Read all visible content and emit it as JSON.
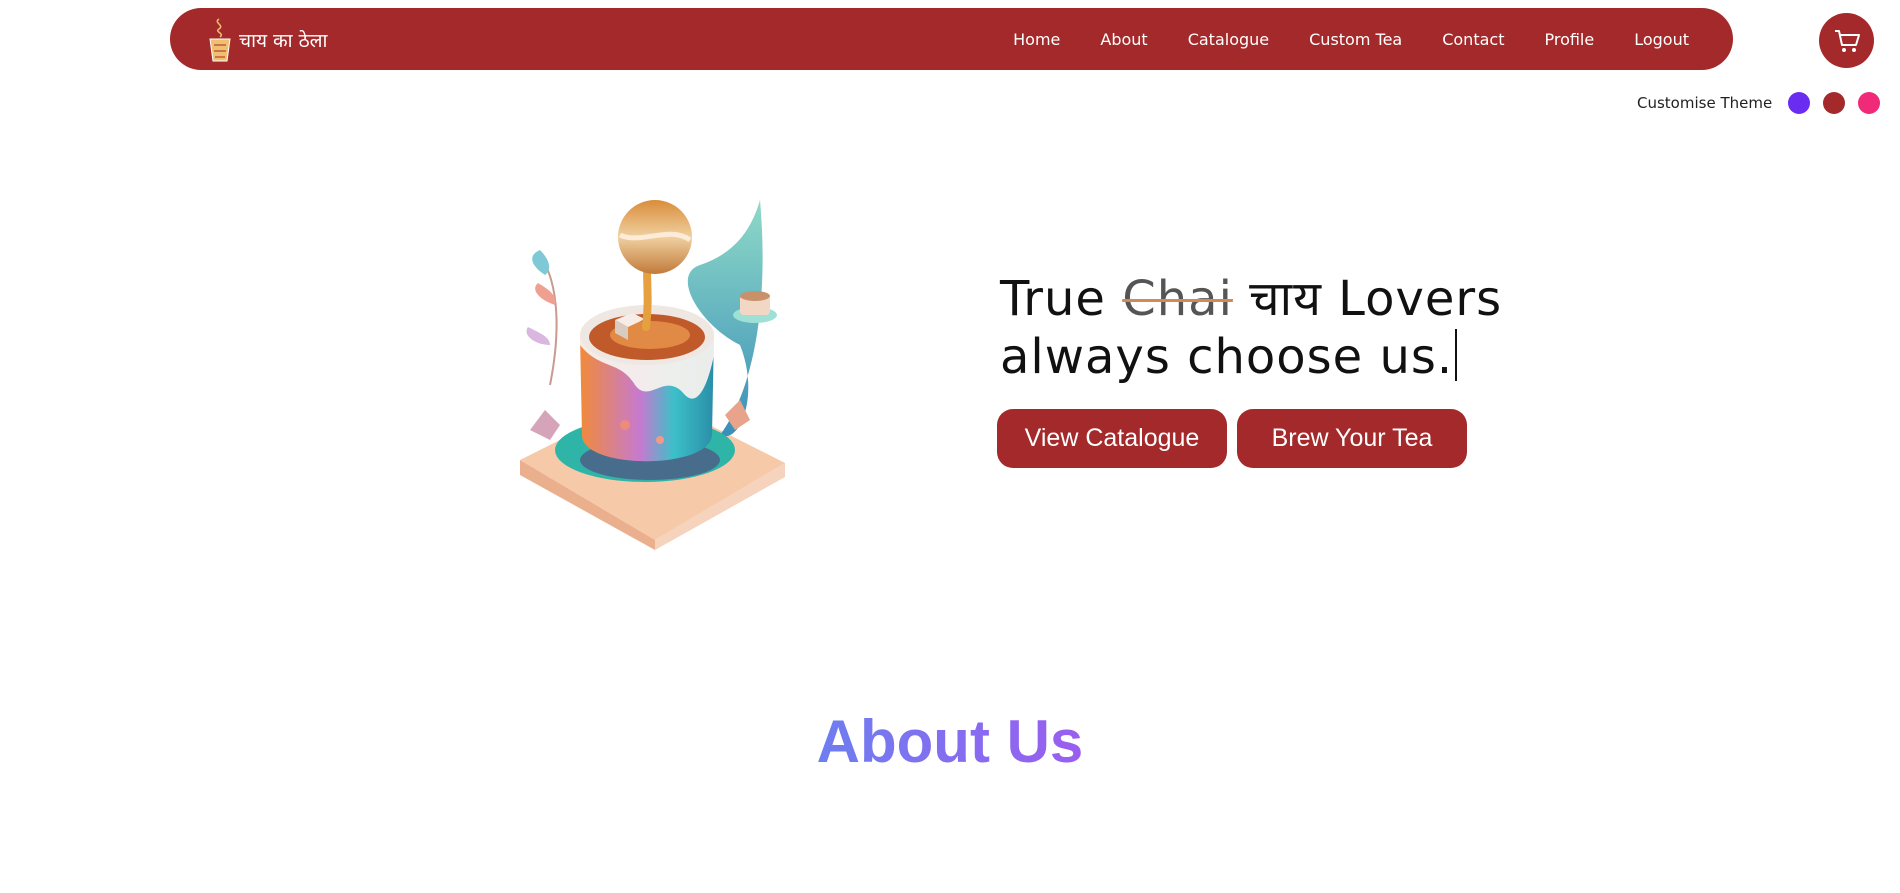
{
  "brand": {
    "name": "चाय का ठेला",
    "icon": "tea-cup-logo-icon"
  },
  "nav": {
    "links": [
      "Home",
      "About",
      "Catalogue",
      "Custom Tea",
      "Contact",
      "Profile",
      "Logout"
    ]
  },
  "cart": {
    "icon": "cart-icon"
  },
  "theme": {
    "label": "Customise Theme",
    "colors": [
      "#6a2cf0",
      "#a4292b",
      "#f02a78"
    ]
  },
  "hero": {
    "line1_a": "True ",
    "line1_strike": "Chai",
    "line1_b": " चाय Lovers",
    "line2": "always choose us.",
    "buttons": {
      "catalogue": "View Catalogue",
      "brew": "Brew Your Tea"
    }
  },
  "about": {
    "title": "About Us"
  },
  "colors": {
    "primary": "#a4292b",
    "accent_gradient": [
      "#6d7ef0",
      "#9a5ef0"
    ]
  }
}
